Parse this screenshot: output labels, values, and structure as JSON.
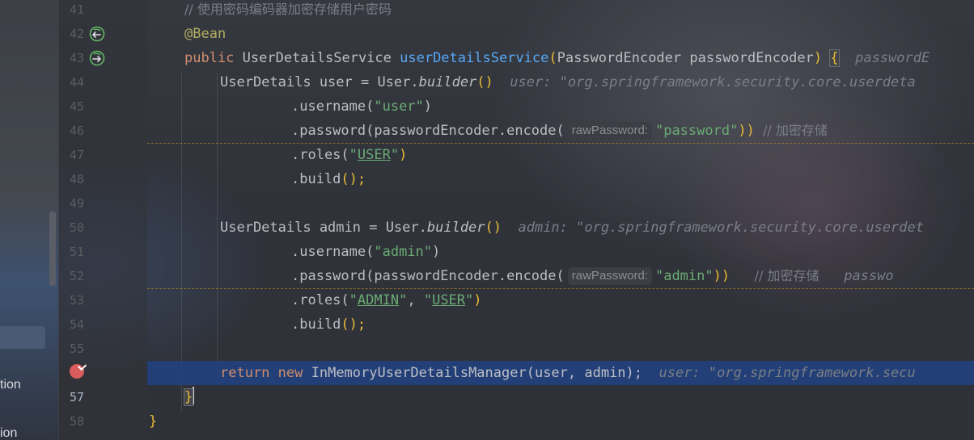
{
  "left_panel": {
    "items": [
      {
        "label": "tion"
      },
      {
        "label": "ion"
      }
    ]
  },
  "gutter": {
    "line_numbers": [
      "41",
      "42",
      "43",
      "44",
      "45",
      "46",
      "47",
      "48",
      "49",
      "50",
      "51",
      "52",
      "53",
      "54",
      "55",
      "",
      "57",
      "58"
    ],
    "current_line": "57",
    "icons": {
      "line42": "bean-navigation-icon",
      "line43": "bean-navigation-icon",
      "line56": "breakpoint-icon"
    }
  },
  "editor": {
    "colors": {
      "keyword": "#cf8e6d",
      "function": "#56a8f5",
      "string": "#6aab73",
      "annotation": "#b3ae60",
      "comment": "#7a7e85",
      "execution_line": "#214283"
    },
    "lines": {
      "l41": {
        "comment": "// 使用密码编码器加密存储用户密码"
      },
      "l42": {
        "annotation": "@Bean"
      },
      "l43": {
        "kw": "public ",
        "type": "UserDetailsService ",
        "fn": "userDetailsService",
        "open": "(",
        "params": "PasswordEncoder passwordEncoder",
        "close": ") ",
        "brace": "{",
        "hint": "  passwordE"
      },
      "l44": {
        "pre": "UserDetails user = User.",
        "call": "builder",
        "paren": "()",
        "hint": "  user: \"org.springframework.security.core.userdeta"
      },
      "l45": {
        "pre": ".username(",
        "str": "\"user\"",
        "post": ")"
      },
      "l46": {
        "pre": ".password(passwordEncoder.encode(",
        "param_hint": "rawPassword:",
        "str": "\"password\"",
        "post": "))",
        "comment": "  // 加密存储"
      },
      "l47": {
        "pre": ".roles(",
        "str_q1": "\"",
        "str": "USER",
        "str_q2": "\"",
        "post": ")"
      },
      "l48": {
        "pre": ".build",
        "post": "();"
      },
      "l50": {
        "pre": "UserDetails admin = User.",
        "call": "builder",
        "paren": "()",
        "hint": "  admin: \"org.springframework.security.core.userdet"
      },
      "l51": {
        "pre": ".username(",
        "str": "\"admin\"",
        "post": ")"
      },
      "l52": {
        "pre": ".password(passwordEncoder.encode(",
        "param_hint": "rawPassword:",
        "str": "\"admin\"",
        "post": "))",
        "comment": "      // 加密存储",
        "hint": "   passwo"
      },
      "l53": {
        "pre": ".roles(",
        "q1": "\"",
        "s1": "ADMIN",
        "q2": "\"",
        "sep": ", ",
        "q3": "\"",
        "s2": "USER",
        "q4": "\"",
        "post": ")"
      },
      "l54": {
        "pre": ".build",
        "post": "();"
      },
      "l56": {
        "kw1": "return ",
        "kw2": "new ",
        "fn": "InMemoryUserDetailsManager",
        "args": "(user, admin);",
        "hint": "  user: \"org.springframework.secu"
      },
      "l57": {
        "brace": "}"
      },
      "l58": {
        "brace": "}"
      }
    }
  }
}
